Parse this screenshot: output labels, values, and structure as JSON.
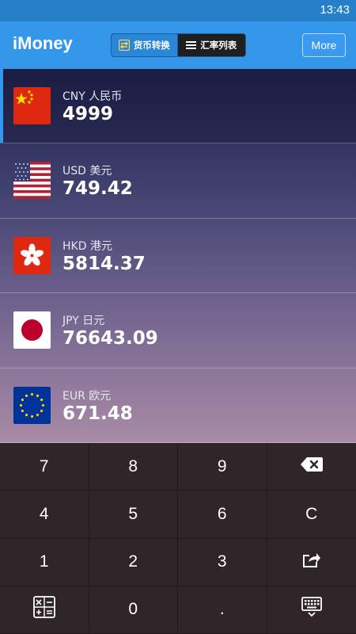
{
  "status_bar": {
    "time": "13:43"
  },
  "app_bar": {
    "title": "iMoney",
    "tabs": [
      {
        "label": "货币转换",
        "icon": "swap-arrows-icon",
        "active": true
      },
      {
        "label": "汇率列表",
        "icon": "list-icon",
        "active": false
      }
    ],
    "more_label": "More"
  },
  "currencies": [
    {
      "code_label": "CNY 人民币",
      "value": "4999",
      "flag": "china-flag-icon",
      "selected": true
    },
    {
      "code_label": "USD 美元",
      "value": "749.42",
      "flag": "usa-flag-icon",
      "selected": false
    },
    {
      "code_label": "HKD 港元",
      "value": "5814.37",
      "flag": "hong-kong-flag-icon",
      "selected": false
    },
    {
      "code_label": "JPY 日元",
      "value": "76643.09",
      "flag": "japan-flag-icon",
      "selected": false
    },
    {
      "code_label": "EUR 欧元",
      "value": "671.48",
      "flag": "eu-flag-icon",
      "selected": false
    }
  ],
  "keypad": {
    "keys": [
      "7",
      "8",
      "9",
      "",
      "4",
      "5",
      "6",
      "C",
      "1",
      "2",
      "3",
      "",
      "",
      "0",
      ".",
      ""
    ],
    "icons": {
      "backspace": "backspace-icon",
      "share": "share-icon",
      "calculator": "calculator-icon",
      "keyboard": "keyboard-hide-icon"
    }
  },
  "colors": {
    "status_bar": "#2680c9",
    "app_bar": "#3597ea",
    "keypad_bg": "#302629",
    "list_gradient_top": "#1f2149",
    "list_gradient_bottom": "#a98ba6"
  }
}
